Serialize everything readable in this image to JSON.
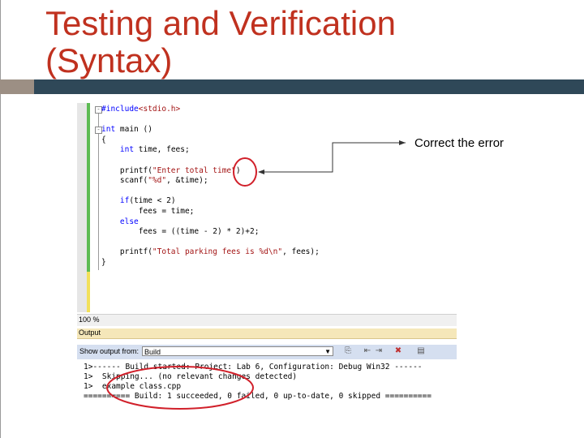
{
  "slide": {
    "title_line1": "Testing and Verification",
    "title_line2": "(Syntax)"
  },
  "colors": {
    "title": "#c0311f",
    "bar_dark": "#2f4858",
    "bar_light": "#9c8f84",
    "annotation_red": "#d1202a",
    "keyword": "#0000ff",
    "string": "#a31515"
  },
  "editor": {
    "lines": [
      {
        "fold": "-",
        "parts": [
          {
            "kw": "#include"
          },
          {
            "str": "<stdio.h>"
          }
        ]
      },
      {
        "parts": []
      },
      {
        "fold": "-",
        "parts": [
          {
            "kw": "int"
          },
          {
            "t": " main ()"
          }
        ]
      },
      {
        "parts": [
          {
            "t": "{"
          }
        ]
      },
      {
        "parts": [
          {
            "t": "    "
          },
          {
            "kw": "int"
          },
          {
            "t": " time, fees;"
          }
        ]
      },
      {
        "parts": []
      },
      {
        "parts": [
          {
            "t": "    printf("
          },
          {
            "str": "\"Enter total time\""
          },
          {
            "t": ")"
          }
        ]
      },
      {
        "parts": [
          {
            "t": "    scanf("
          },
          {
            "str": "\"%d\""
          },
          {
            "t": ", &time);"
          }
        ]
      },
      {
        "parts": []
      },
      {
        "parts": [
          {
            "t": "    "
          },
          {
            "kw": "if"
          },
          {
            "t": "(time < 2)"
          }
        ]
      },
      {
        "parts": [
          {
            "t": "        fees = time;"
          }
        ]
      },
      {
        "parts": [
          {
            "t": "    "
          },
          {
            "kw": "else"
          }
        ]
      },
      {
        "parts": [
          {
            "t": "        fees = ((time - 2) * 2)+2;"
          }
        ]
      },
      {
        "parts": []
      },
      {
        "parts": [
          {
            "t": "    printf("
          },
          {
            "str": "\"Total parking fees is %d\\n\""
          },
          {
            "t": ", fees);"
          }
        ]
      },
      {
        "parts": [
          {
            "t": "}"
          }
        ]
      }
    ]
  },
  "zoom": "100 %",
  "output": {
    "title": "Output",
    "show_label": "Show output from:",
    "source": "Build",
    "lines": [
      "1>------ Build started: Project: Lab 6, Configuration: Debug Win32 ------",
      "1>  Skipping... (no relevant changes detected)",
      "1>  example class.cpp",
      "========== Build: 1 succeeded, 0 failed, 0 up-to-date, 0 skipped =========="
    ]
  },
  "annotation": {
    "label": "Correct the error"
  }
}
